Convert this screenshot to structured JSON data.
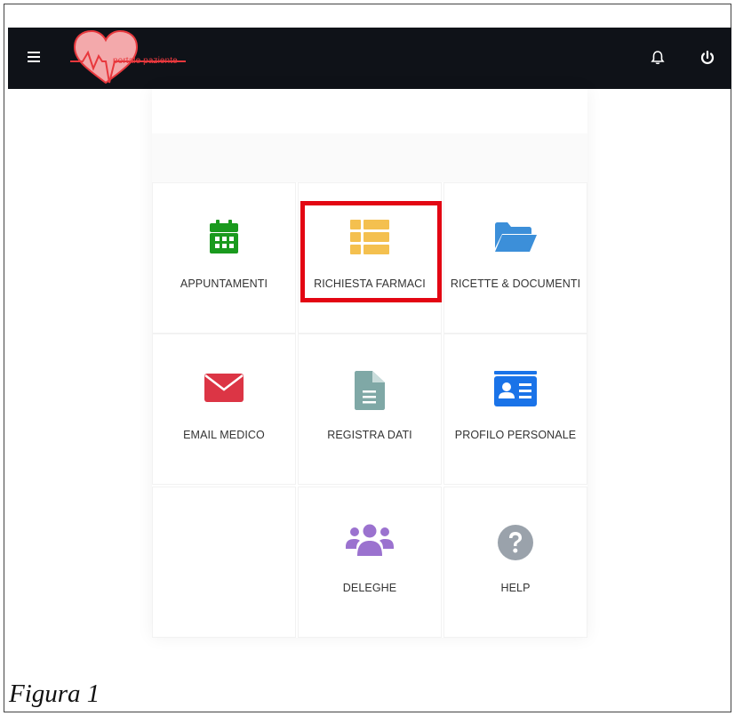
{
  "header": {
    "logo_text": "portale paziente",
    "menu_icon": "hamburger-icon",
    "notifications_icon": "bell-icon",
    "logout_icon": "power-icon"
  },
  "tiles": [
    {
      "label": "APPUNTAMENTI",
      "icon": "calendar-icon",
      "color": "#1a9a1e"
    },
    {
      "label": "RICHIESTA FARMACI",
      "icon": "list-icon",
      "color": "#f4c04f"
    },
    {
      "label": "RICETTE & DOCUMENTI",
      "icon": "folder-icon",
      "color": "#3c8fd9"
    },
    {
      "label": "EMAIL MEDICO",
      "icon": "envelope-icon",
      "color": "#dc3545"
    },
    {
      "label": "REGISTRA DATI",
      "icon": "document-icon",
      "color": "#7fa8a6"
    },
    {
      "label": "PROFILO PERSONALE",
      "icon": "id-card-icon",
      "color": "#1a73e8"
    },
    {
      "label": "DELEGHE",
      "icon": "users-icon",
      "color": "#9b72cf"
    },
    {
      "label": "HELP",
      "icon": "question-icon",
      "color": "#9aa2ab"
    }
  ],
  "highlight_color": "#e30613",
  "caption": "Figura 1"
}
